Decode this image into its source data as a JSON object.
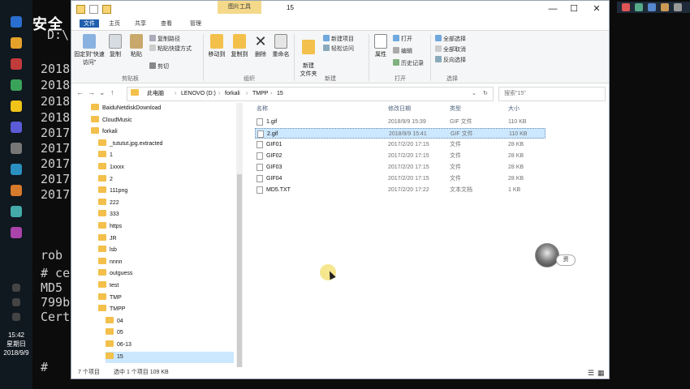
{
  "watermark": "炮炮安全",
  "terminal": {
    "drive_prefix": "D:\\",
    "years": [
      "2018",
      "2018",
      "2018",
      "2018",
      "2017",
      "2017",
      "2017",
      "2017",
      "2017"
    ],
    "lower_lines": [
      "# ce",
      "MD5",
      "799b",
      "Cert"
    ],
    "prompt": "#",
    "partial_word": "rob"
  },
  "taskbar": {
    "time": "15:42",
    "weekday": "星期日",
    "date": "2018/9/9"
  },
  "window": {
    "title": "15",
    "picture_tools_tab": "图片工具",
    "tabs": [
      "文件",
      "主页",
      "共享",
      "查看",
      "管理"
    ]
  },
  "ribbon": {
    "groups": [
      "剪贴板",
      "组织",
      "新建",
      "打开",
      "选择"
    ],
    "pin_quick_access": "固定到\"快速访问\"",
    "copy": "复制",
    "paste": "粘贴",
    "copy_path": "复制路径",
    "paste_shortcut": "粘贴快捷方式",
    "cut": "剪切",
    "move_to": "移动到",
    "copy_to": "复制到",
    "delete": "删除",
    "rename": "重命名",
    "new_folder": "新建\n文件夹",
    "new_item": "新建项目",
    "easy_access": "轻松访问",
    "properties": "属性",
    "open": "打开",
    "edit": "编辑",
    "history": "历史记录",
    "select_all": "全部选择",
    "select_none": "全部取消",
    "invert_selection": "反向选择"
  },
  "address": {
    "crumbs": [
      "此电脑",
      "LENOVO (D:)",
      "forkali",
      "TMPP",
      "15"
    ],
    "search_placeholder": "搜索\"15\""
  },
  "nav_tree": [
    {
      "label": "BaiduNetdiskDownload",
      "indent": 0
    },
    {
      "label": "CloudMusic",
      "indent": 0
    },
    {
      "label": "forkali",
      "indent": 0
    },
    {
      "label": "_tututut.jpg.extracted",
      "indent": 1
    },
    {
      "label": "1",
      "indent": 1
    },
    {
      "label": "1xxxx",
      "indent": 1
    },
    {
      "label": "2",
      "indent": 1
    },
    {
      "label": "111png",
      "indent": 1
    },
    {
      "label": "222",
      "indent": 1
    },
    {
      "label": "333",
      "indent": 1
    },
    {
      "label": "https",
      "indent": 1
    },
    {
      "label": "JR",
      "indent": 1
    },
    {
      "label": "lsb",
      "indent": 1
    },
    {
      "label": "nnnn",
      "indent": 1
    },
    {
      "label": "outguess",
      "indent": 1
    },
    {
      "label": "test",
      "indent": 1
    },
    {
      "label": "TMP",
      "indent": 1
    },
    {
      "label": "TMPP",
      "indent": 1
    },
    {
      "label": "04",
      "indent": 2
    },
    {
      "label": "05",
      "indent": 2
    },
    {
      "label": "06-13",
      "indent": 2
    },
    {
      "label": "15",
      "indent": 2
    }
  ],
  "columns": {
    "name": "名称",
    "modified": "修改日期",
    "type": "类型",
    "size": "大小"
  },
  "files": [
    {
      "name": "1.gif",
      "modified": "2018/9/9 15:39",
      "type": "GIF 文件",
      "size": "110 KB"
    },
    {
      "name": "2.gif",
      "modified": "2018/9/9 15:41",
      "type": "GIF 文件",
      "size": "110 KB"
    },
    {
      "name": "GIF01",
      "modified": "2017/2/20 17:15",
      "type": "文件",
      "size": "28 KB"
    },
    {
      "name": "GIF02",
      "modified": "2017/2/20 17:15",
      "type": "文件",
      "size": "28 KB"
    },
    {
      "name": "GIF03",
      "modified": "2017/2/20 17:15",
      "type": "文件",
      "size": "28 KB"
    },
    {
      "name": "GIF04",
      "modified": "2017/2/20 17:15",
      "type": "文件",
      "size": "28 KB"
    },
    {
      "name": "MD5.TXT",
      "modified": "2017/2/20 17:22",
      "type": "文本文档",
      "size": "1 KB"
    }
  ],
  "status": {
    "count": "7 个项目",
    "selected": "选中 1 个项目  109 KB"
  },
  "bubble_text": "资",
  "colors": {
    "folder": "#f3c04b",
    "selection": "#cce8ff",
    "picture_tools": "#f4d98a",
    "terminal_bg": "#0c0c0c"
  }
}
